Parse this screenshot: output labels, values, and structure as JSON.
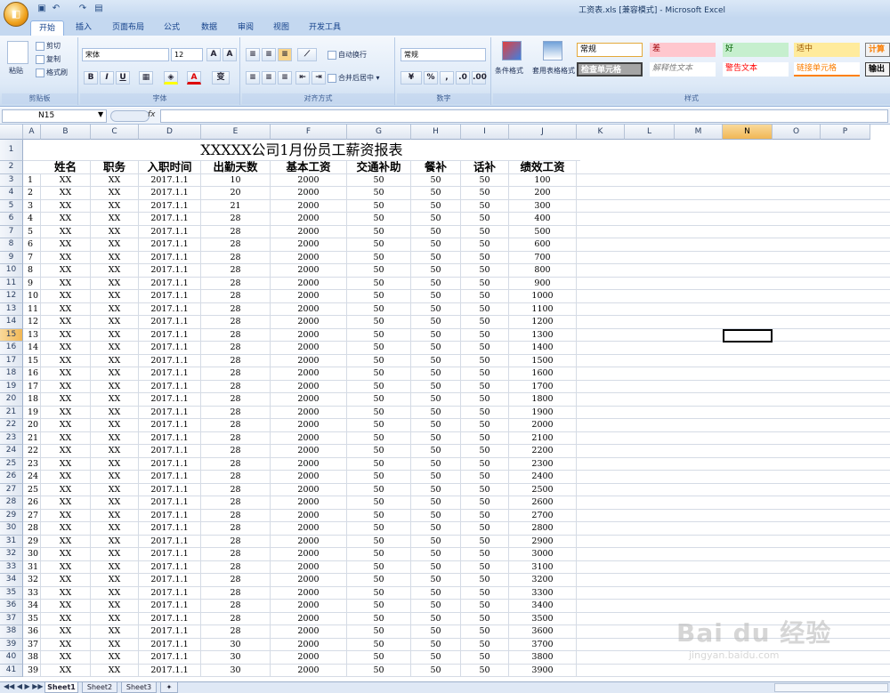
{
  "window": {
    "title": "工资表.xls  [兼容模式] - Microsoft Excel"
  },
  "tabs": [
    "开始",
    "插入",
    "页面布局",
    "公式",
    "数据",
    "审阅",
    "视图",
    "开发工具"
  ],
  "ribbon": {
    "clipboard": {
      "label": "剪贴板",
      "paste": "粘贴",
      "cut": "剪切",
      "copy": "复制",
      "format_painter": "格式刷"
    },
    "font": {
      "label": "字体",
      "name": "宋体",
      "size": "12",
      "bold": "B",
      "italic": "I",
      "underline": "U",
      "wen": "变"
    },
    "alignment": {
      "label": "对齐方式",
      "wrap": "自动换行",
      "merge": "合并后居中"
    },
    "number": {
      "label": "数字",
      "format": "常规",
      "percent": "%"
    },
    "styles": {
      "label": "样式",
      "cond_format": "条件格式",
      "table_format": "套用表格格式",
      "normal": "常规",
      "bad": "差",
      "good": "好",
      "neutral": "适中",
      "calc": "计算",
      "check": "检查单元格",
      "explain": "解释性文本",
      "warn": "警告文本",
      "link": "链接单元格",
      "output": "输出"
    }
  },
  "formula": {
    "namebox": "N15",
    "fx": "fx"
  },
  "columns": [
    "A",
    "B",
    "C",
    "D",
    "E",
    "F",
    "G",
    "H",
    "I",
    "J",
    "K",
    "L",
    "M",
    "N",
    "O",
    "P"
  ],
  "selected_col": "N",
  "selected_row": "15",
  "sheet_title": "XXXXX公司1月份员工薪资报表",
  "headers": [
    "姓名",
    "职务",
    "入职时间",
    "出勤天数",
    "基本工资",
    "交通补助",
    "餐补",
    "话补",
    "绩效工资"
  ],
  "rows": [
    [
      "1",
      "XX",
      "XX",
      "2017.1.1",
      "10",
      "2000",
      "50",
      "50",
      "50",
      "100"
    ],
    [
      "2",
      "XX",
      "XX",
      "2017.1.1",
      "20",
      "2000",
      "50",
      "50",
      "50",
      "200"
    ],
    [
      "3",
      "XX",
      "XX",
      "2017.1.1",
      "21",
      "2000",
      "50",
      "50",
      "50",
      "300"
    ],
    [
      "4",
      "XX",
      "XX",
      "2017.1.1",
      "28",
      "2000",
      "50",
      "50",
      "50",
      "400"
    ],
    [
      "5",
      "XX",
      "XX",
      "2017.1.1",
      "28",
      "2000",
      "50",
      "50",
      "50",
      "500"
    ],
    [
      "6",
      "XX",
      "XX",
      "2017.1.1",
      "28",
      "2000",
      "50",
      "50",
      "50",
      "600"
    ],
    [
      "7",
      "XX",
      "XX",
      "2017.1.1",
      "28",
      "2000",
      "50",
      "50",
      "50",
      "700"
    ],
    [
      "8",
      "XX",
      "XX",
      "2017.1.1",
      "28",
      "2000",
      "50",
      "50",
      "50",
      "800"
    ],
    [
      "9",
      "XX",
      "XX",
      "2017.1.1",
      "28",
      "2000",
      "50",
      "50",
      "50",
      "900"
    ],
    [
      "10",
      "XX",
      "XX",
      "2017.1.1",
      "28",
      "2000",
      "50",
      "50",
      "50",
      "1000"
    ],
    [
      "11",
      "XX",
      "XX",
      "2017.1.1",
      "28",
      "2000",
      "50",
      "50",
      "50",
      "1100"
    ],
    [
      "12",
      "XX",
      "XX",
      "2017.1.1",
      "28",
      "2000",
      "50",
      "50",
      "50",
      "1200"
    ],
    [
      "13",
      "XX",
      "XX",
      "2017.1.1",
      "28",
      "2000",
      "50",
      "50",
      "50",
      "1300"
    ],
    [
      "14",
      "XX",
      "XX",
      "2017.1.1",
      "28",
      "2000",
      "50",
      "50",
      "50",
      "1400"
    ],
    [
      "15",
      "XX",
      "XX",
      "2017.1.1",
      "28",
      "2000",
      "50",
      "50",
      "50",
      "1500"
    ],
    [
      "16",
      "XX",
      "XX",
      "2017.1.1",
      "28",
      "2000",
      "50",
      "50",
      "50",
      "1600"
    ],
    [
      "17",
      "XX",
      "XX",
      "2017.1.1",
      "28",
      "2000",
      "50",
      "50",
      "50",
      "1700"
    ],
    [
      "18",
      "XX",
      "XX",
      "2017.1.1",
      "28",
      "2000",
      "50",
      "50",
      "50",
      "1800"
    ],
    [
      "19",
      "XX",
      "XX",
      "2017.1.1",
      "28",
      "2000",
      "50",
      "50",
      "50",
      "1900"
    ],
    [
      "20",
      "XX",
      "XX",
      "2017.1.1",
      "28",
      "2000",
      "50",
      "50",
      "50",
      "2000"
    ],
    [
      "21",
      "XX",
      "XX",
      "2017.1.1",
      "28",
      "2000",
      "50",
      "50",
      "50",
      "2100"
    ],
    [
      "22",
      "XX",
      "XX",
      "2017.1.1",
      "28",
      "2000",
      "50",
      "50",
      "50",
      "2200"
    ],
    [
      "23",
      "XX",
      "XX",
      "2017.1.1",
      "28",
      "2000",
      "50",
      "50",
      "50",
      "2300"
    ],
    [
      "24",
      "XX",
      "XX",
      "2017.1.1",
      "28",
      "2000",
      "50",
      "50",
      "50",
      "2400"
    ],
    [
      "25",
      "XX",
      "XX",
      "2017.1.1",
      "28",
      "2000",
      "50",
      "50",
      "50",
      "2500"
    ],
    [
      "26",
      "XX",
      "XX",
      "2017.1.1",
      "28",
      "2000",
      "50",
      "50",
      "50",
      "2600"
    ],
    [
      "27",
      "XX",
      "XX",
      "2017.1.1",
      "28",
      "2000",
      "50",
      "50",
      "50",
      "2700"
    ],
    [
      "28",
      "XX",
      "XX",
      "2017.1.1",
      "28",
      "2000",
      "50",
      "50",
      "50",
      "2800"
    ],
    [
      "29",
      "XX",
      "XX",
      "2017.1.1",
      "28",
      "2000",
      "50",
      "50",
      "50",
      "2900"
    ],
    [
      "30",
      "XX",
      "XX",
      "2017.1.1",
      "28",
      "2000",
      "50",
      "50",
      "50",
      "3000"
    ],
    [
      "31",
      "XX",
      "XX",
      "2017.1.1",
      "28",
      "2000",
      "50",
      "50",
      "50",
      "3100"
    ],
    [
      "32",
      "XX",
      "XX",
      "2017.1.1",
      "28",
      "2000",
      "50",
      "50",
      "50",
      "3200"
    ],
    [
      "33",
      "XX",
      "XX",
      "2017.1.1",
      "28",
      "2000",
      "50",
      "50",
      "50",
      "3300"
    ],
    [
      "34",
      "XX",
      "XX",
      "2017.1.1",
      "28",
      "2000",
      "50",
      "50",
      "50",
      "3400"
    ],
    [
      "35",
      "XX",
      "XX",
      "2017.1.1",
      "28",
      "2000",
      "50",
      "50",
      "50",
      "3500"
    ],
    [
      "36",
      "XX",
      "XX",
      "2017.1.1",
      "28",
      "2000",
      "50",
      "50",
      "50",
      "3600"
    ],
    [
      "37",
      "XX",
      "XX",
      "2017.1.1",
      "30",
      "2000",
      "50",
      "50",
      "50",
      "3700"
    ],
    [
      "38",
      "XX",
      "XX",
      "2017.1.1",
      "30",
      "2000",
      "50",
      "50",
      "50",
      "3800"
    ],
    [
      "39",
      "XX",
      "XX",
      "2017.1.1",
      "30",
      "2000",
      "50",
      "50",
      "50",
      "3900"
    ]
  ],
  "sheets": [
    "Sheet1",
    "Sheet2",
    "Sheet3"
  ],
  "watermark": {
    "brand": "Bai du 经验",
    "url": "jingyan.baidu.com"
  }
}
